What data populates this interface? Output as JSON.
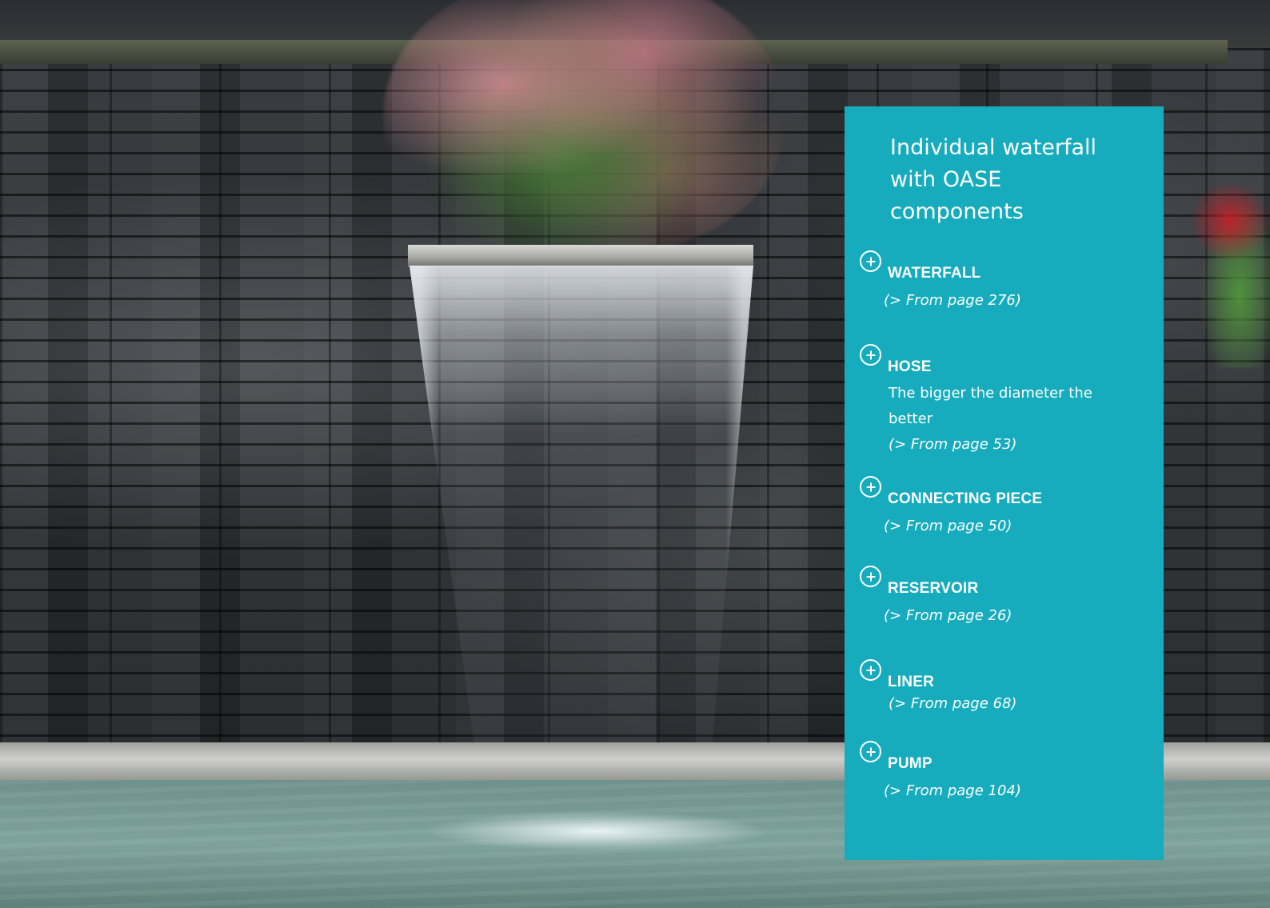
{
  "panel": {
    "title": "Individual waterfall\nwith OASE\ncomponents",
    "items": [
      {
        "title": "WATERFALL",
        "description": "",
        "reference": "(> From page 276)"
      },
      {
        "title": "HOSE",
        "description": "The bigger the diameter the better",
        "reference": "(> From page 53)"
      },
      {
        "title": "CONNECTING PIECE",
        "description": "",
        "reference": "(> From page 50)"
      },
      {
        "title": "RESERVOIR",
        "description": "",
        "reference": "(> From page 26)"
      },
      {
        "title": "LINER",
        "description": "",
        "reference": "(> From page 68)"
      },
      {
        "title": "PUMP",
        "description": "",
        "reference": "(> From page 104)"
      }
    ],
    "item_icon": "plus-circle-icon",
    "background_color": "#16acbd",
    "text_color": "#ffffff"
  }
}
